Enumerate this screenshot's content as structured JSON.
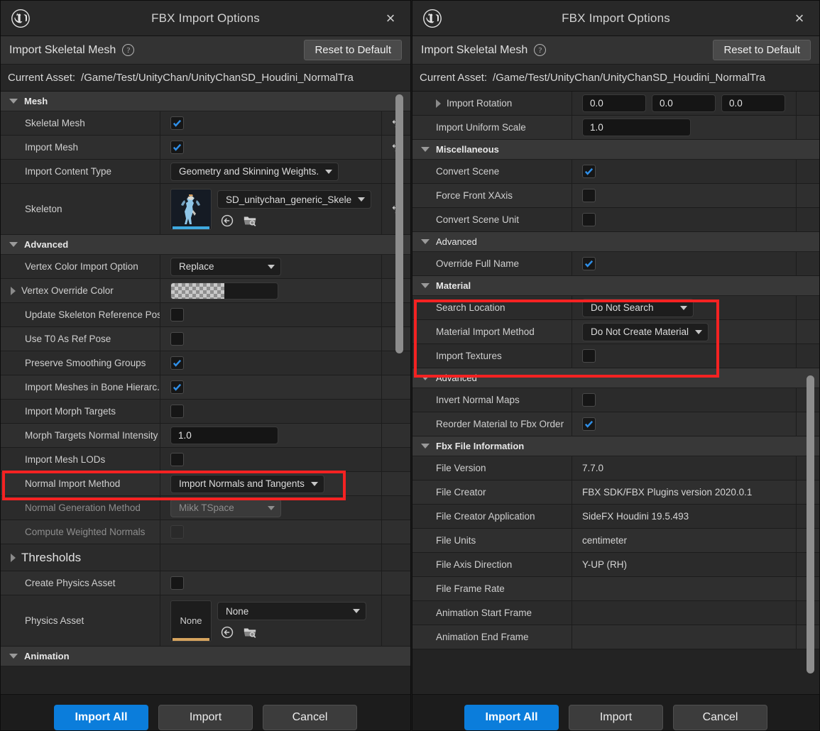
{
  "theme": {
    "accent": "#0b7ddb",
    "highlight": "#f42222",
    "check": "#2f8fe8",
    "panel_bg": "#242424",
    "category_bg": "#383838"
  },
  "windows": [
    {
      "id": "left",
      "title": "FBX Import Options",
      "logo": "unreal-engine-icon",
      "close": "×",
      "subheader": {
        "title": "Import Skeletal Mesh",
        "help_icon": "?",
        "reset_label": "Reset to Default"
      },
      "asset_bar": {
        "label": "Current Asset:",
        "path": "/Game/Test/UnityChan/UnityChanSD_Houdini_NormalTra"
      },
      "sections": [
        {
          "name": "Mesh",
          "expanded": true,
          "rows": [
            {
              "label": "Skeletal Mesh",
              "type": "checkbox",
              "checked": true,
              "revert": true
            },
            {
              "label": "Import Mesh",
              "type": "checkbox",
              "checked": true,
              "revert": true
            },
            {
              "label": "Import Content Type",
              "type": "combo",
              "value": "Geometry and Skinning Weights."
            },
            {
              "label": "Skeleton",
              "type": "asset",
              "value": "SD_unitychan_generic_Skele",
              "thumb": "skeleton-thumbnail",
              "revert": true
            }
          ]
        },
        {
          "name": "Advanced",
          "expanded": true,
          "rows": [
            {
              "label": "Vertex Color Import Option",
              "type": "combo",
              "value": "Replace"
            },
            {
              "label": "Vertex Override Color",
              "type": "color",
              "expandable": true
            },
            {
              "label": "Update Skeleton Reference Pose",
              "type": "checkbox",
              "checked": false
            },
            {
              "label": "Use T0 As Ref Pose",
              "type": "checkbox",
              "checked": false
            },
            {
              "label": "Preserve Smoothing Groups",
              "type": "checkbox",
              "checked": true
            },
            {
              "label": "Import Meshes in Bone Hierarc...",
              "type": "checkbox",
              "checked": true
            },
            {
              "label": "Import Morph Targets",
              "type": "checkbox",
              "checked": false
            },
            {
              "label": "Morph Targets Normal Intensity",
              "type": "number",
              "value": "1.0"
            },
            {
              "label": "Import Mesh LODs",
              "type": "checkbox",
              "checked": false
            },
            {
              "label": "Normal Import Method",
              "type": "combo",
              "value": "Import Normals and Tangents",
              "highlighted": true
            },
            {
              "label": "Normal Generation Method",
              "type": "combo",
              "value": "Mikk TSpace",
              "disabled": true
            },
            {
              "label": "Compute Weighted Normals",
              "type": "checkbox",
              "checked": false,
              "disabled": true
            },
            {
              "label": "Thresholds",
              "type": "group",
              "expanded": false
            },
            {
              "label": "Create Physics Asset",
              "type": "checkbox",
              "checked": false
            },
            {
              "label": "Physics Asset",
              "type": "asset",
              "value": "None",
              "thumb": "None"
            }
          ]
        },
        {
          "name": "Animation",
          "expanded": true,
          "rows": []
        }
      ],
      "footer": {
        "import_all": "Import All",
        "import": "Import",
        "cancel": "Cancel"
      }
    },
    {
      "id": "right",
      "title": "FBX Import Options",
      "logo": "unreal-engine-icon",
      "close": "×",
      "subheader": {
        "title": "Import Skeletal Mesh",
        "help_icon": "?",
        "reset_label": "Reset to Default"
      },
      "asset_bar": {
        "label": "Current Asset:",
        "path": "/Game/Test/UnityChan/UnityChanSD_Houdini_NormalTra"
      },
      "sections": [
        {
          "name": "",
          "expanded": true,
          "rows": [
            {
              "label": "Import Rotation",
              "type": "vector3",
              "values": [
                "0.0",
                "0.0",
                "0.0"
              ],
              "expandable": true
            },
            {
              "label": "Import Uniform Scale",
              "type": "number",
              "value": "1.0"
            }
          ]
        },
        {
          "name": "Miscellaneous",
          "expanded": true,
          "rows": [
            {
              "label": "Convert Scene",
              "type": "checkbox",
              "checked": true
            },
            {
              "label": "Force Front XAxis",
              "type": "checkbox",
              "checked": false
            },
            {
              "label": "Convert Scene Unit",
              "type": "checkbox",
              "checked": false
            }
          ]
        },
        {
          "name": "Advanced",
          "expanded": true,
          "rows": [
            {
              "label": "Override Full Name",
              "type": "checkbox",
              "checked": true
            }
          ]
        },
        {
          "name": "Material",
          "expanded": true,
          "rows": [
            {
              "label": "Search Location",
              "type": "combo",
              "value": "Do Not Search",
              "highlighted": true
            },
            {
              "label": "Material Import Method",
              "type": "combo",
              "value": "Do Not Create Material",
              "highlighted": true
            },
            {
              "label": "Import Textures",
              "type": "checkbox",
              "checked": false,
              "highlighted": true
            }
          ]
        },
        {
          "name": "Advanced",
          "expanded": true,
          "rows": [
            {
              "label": "Invert Normal Maps",
              "type": "checkbox",
              "checked": false
            },
            {
              "label": "Reorder Material to Fbx Order",
              "type": "checkbox",
              "checked": true
            }
          ]
        },
        {
          "name": "Fbx File Information",
          "expanded": true,
          "rows": [
            {
              "label": "File Version",
              "type": "text",
              "value": "7.7.0"
            },
            {
              "label": "File Creator",
              "type": "text",
              "value": "FBX SDK/FBX Plugins version 2020.0.1"
            },
            {
              "label": "File Creator Application",
              "type": "text",
              "value": "SideFX Houdini 19.5.493"
            },
            {
              "label": "File Units",
              "type": "text",
              "value": "centimeter"
            },
            {
              "label": "File Axis Direction",
              "type": "text",
              "value": "Y-UP (RH)"
            },
            {
              "label": "File Frame Rate",
              "type": "text",
              "value": ""
            },
            {
              "label": "Animation Start Frame",
              "type": "text",
              "value": ""
            },
            {
              "label": "Animation End Frame",
              "type": "text",
              "value": ""
            }
          ]
        }
      ],
      "footer": {
        "import_all": "Import All",
        "import": "Import",
        "cancel": "Cancel"
      }
    }
  ]
}
